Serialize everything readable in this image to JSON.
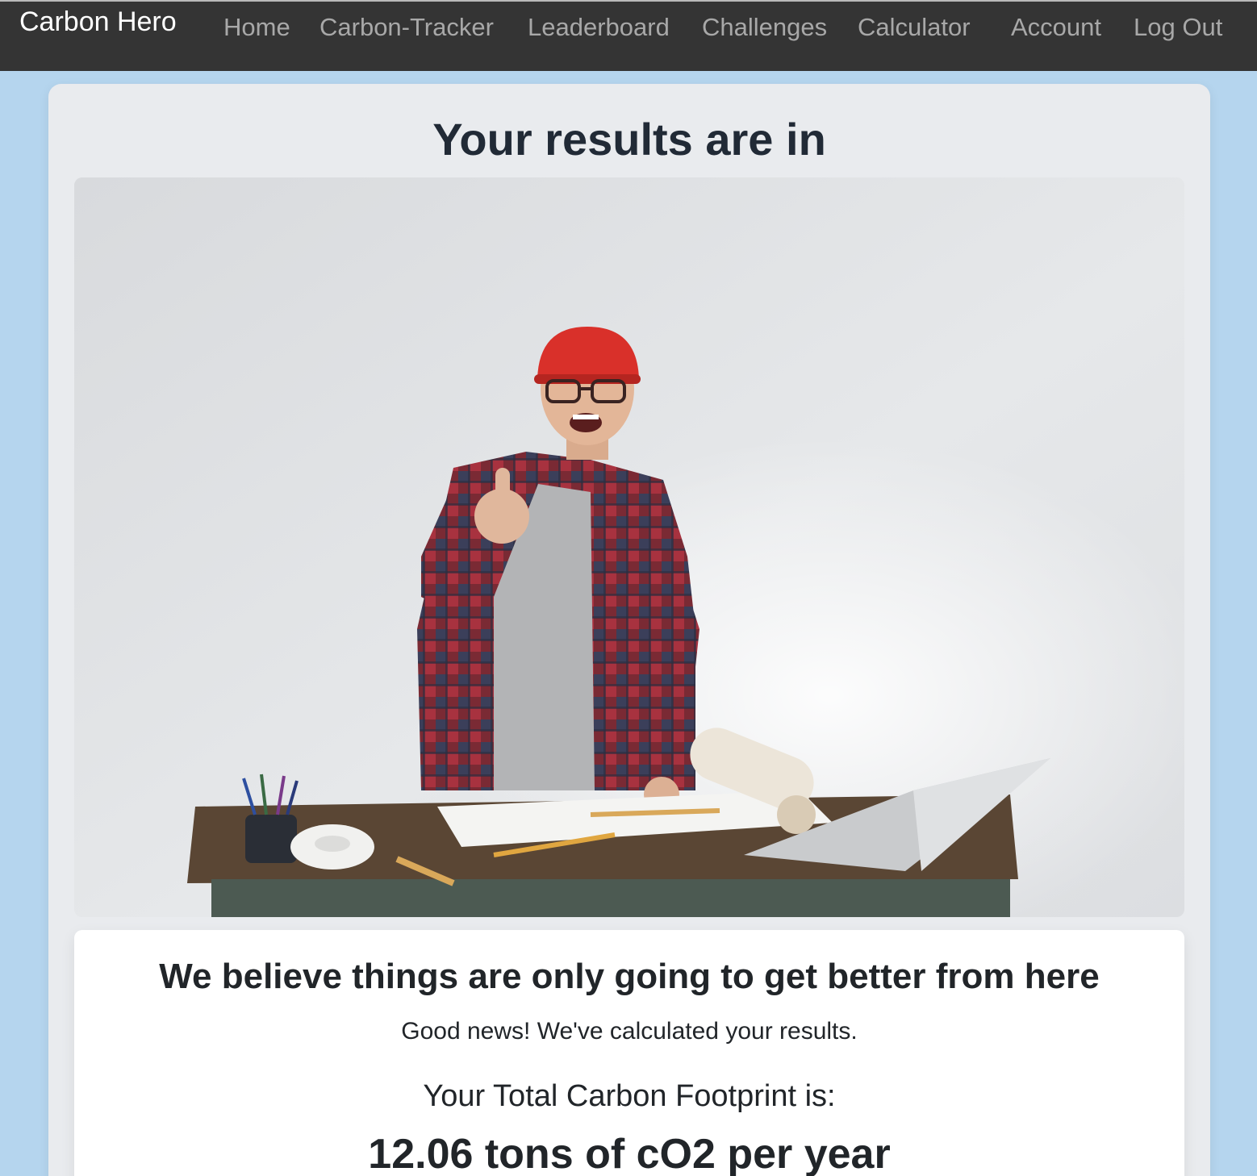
{
  "navbar": {
    "brand": "Carbon Hero",
    "links": [
      {
        "label": "Home"
      },
      {
        "label": "Carbon-Tracker"
      },
      {
        "label": "Leaderboard"
      },
      {
        "label": "Challenges"
      },
      {
        "label": "Calculator"
      },
      {
        "label": "Account"
      },
      {
        "label": "Log Out"
      }
    ]
  },
  "main": {
    "title": "Your results are in",
    "hero_image": "happy-engineer-thumbs-up-photo"
  },
  "results": {
    "heading": "We believe things are only going to get better from here",
    "message": "Good news! We've calculated your results.",
    "footprint_label": "Your Total Carbon Footprint is:",
    "footprint_value": "12.06 tons of cO2 per year"
  },
  "colors": {
    "navbar_bg": "#343434",
    "page_bg": "#b5d5ee",
    "card_bg": "#e9ebee",
    "nav_link": "#a8a8a8",
    "brand": "#ffffff"
  }
}
